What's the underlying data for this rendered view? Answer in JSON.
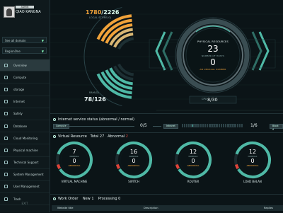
{
  "sidebar": {
    "role": "ADMIN",
    "username": "QIAO KANGNA",
    "domain_select": "See all domain",
    "region_select": "RegionOne",
    "items": [
      {
        "label": "Overview",
        "icon": "dashboard-icon",
        "active": true
      },
      {
        "label": "Compute",
        "icon": "compute-icon"
      },
      {
        "label": "storage",
        "icon": "storage-icon"
      },
      {
        "label": "Internet",
        "icon": "network-icon"
      },
      {
        "label": "Safety",
        "icon": "shield-icon"
      },
      {
        "label": "Database",
        "icon": "database-icon"
      },
      {
        "label": "Cloud Monitoring",
        "icon": "monitor-icon"
      },
      {
        "label": "Physical machine",
        "icon": "server-icon"
      },
      {
        "label": "Technical Support",
        "icon": "support-icon"
      },
      {
        "label": "System Management",
        "icon": "gear-icon"
      },
      {
        "label": "User Management",
        "icon": "user-icon"
      },
      {
        "label": "Trash",
        "icon": "trash-icon"
      }
    ],
    "footer": "EXIT"
  },
  "storage": {
    "used": "1780",
    "total": "2226",
    "label": "LOCAL STORE(G)"
  },
  "ram": {
    "label": "RAM(G)",
    "used": "78",
    "total": "126"
  },
  "physical": {
    "title": "PHYSICAL RESOURCES",
    "hosts": "23",
    "hosts_label": "NUMBER OF HOSTS",
    "unusual": "0",
    "unusual_label": "AN UNUSUAL NUMBER",
    "cpu_label": "CPU",
    "cpu_used": "8",
    "cpu_total": "30"
  },
  "internet": {
    "title": "Internet service status (abnormal / normal)",
    "compute_btn": "Compute",
    "compute_val": "0/5",
    "second_btn": "Intranet",
    "second_val": "1/6",
    "third_btn": "Block d",
    "progress_filled": 0.2
  },
  "virtual": {
    "title": "Virtual Resource",
    "total_label": "Total",
    "total": "27",
    "abnormal_label": "Abnormal",
    "abnormal": "2",
    "items": [
      {
        "label": "VIRTUAL MACHINE",
        "normal": "7",
        "normal_label": "NORMAL",
        "abnormal": "0",
        "abnormal_label": "ABNORMAL"
      },
      {
        "label": "SWITCH",
        "normal": "16",
        "normal_label": "NORMAL",
        "abnormal": "0",
        "abnormal_label": "ABNORMAL"
      },
      {
        "label": "ROUTER",
        "normal": "12",
        "normal_label": "NORMAL",
        "abnormal": "0",
        "abnormal_label": "ABNORMAL"
      },
      {
        "label": "LOAD BALAN",
        "normal": "12",
        "normal_label": "NORMAL",
        "abnormal": "0",
        "abnormal_label": "ABNORMAL"
      }
    ]
  },
  "workorder": {
    "title": "Work Order",
    "new_label": "New",
    "new": "1",
    "processing_label": "Processing",
    "processing": "0",
    "columns": [
      "Website title",
      "Description",
      "Replies"
    ]
  },
  "colors": {
    "accent": "#4fb9a6",
    "bg": "#0b1417",
    "warn": "#f0a23a",
    "alert": "#e0443a"
  }
}
